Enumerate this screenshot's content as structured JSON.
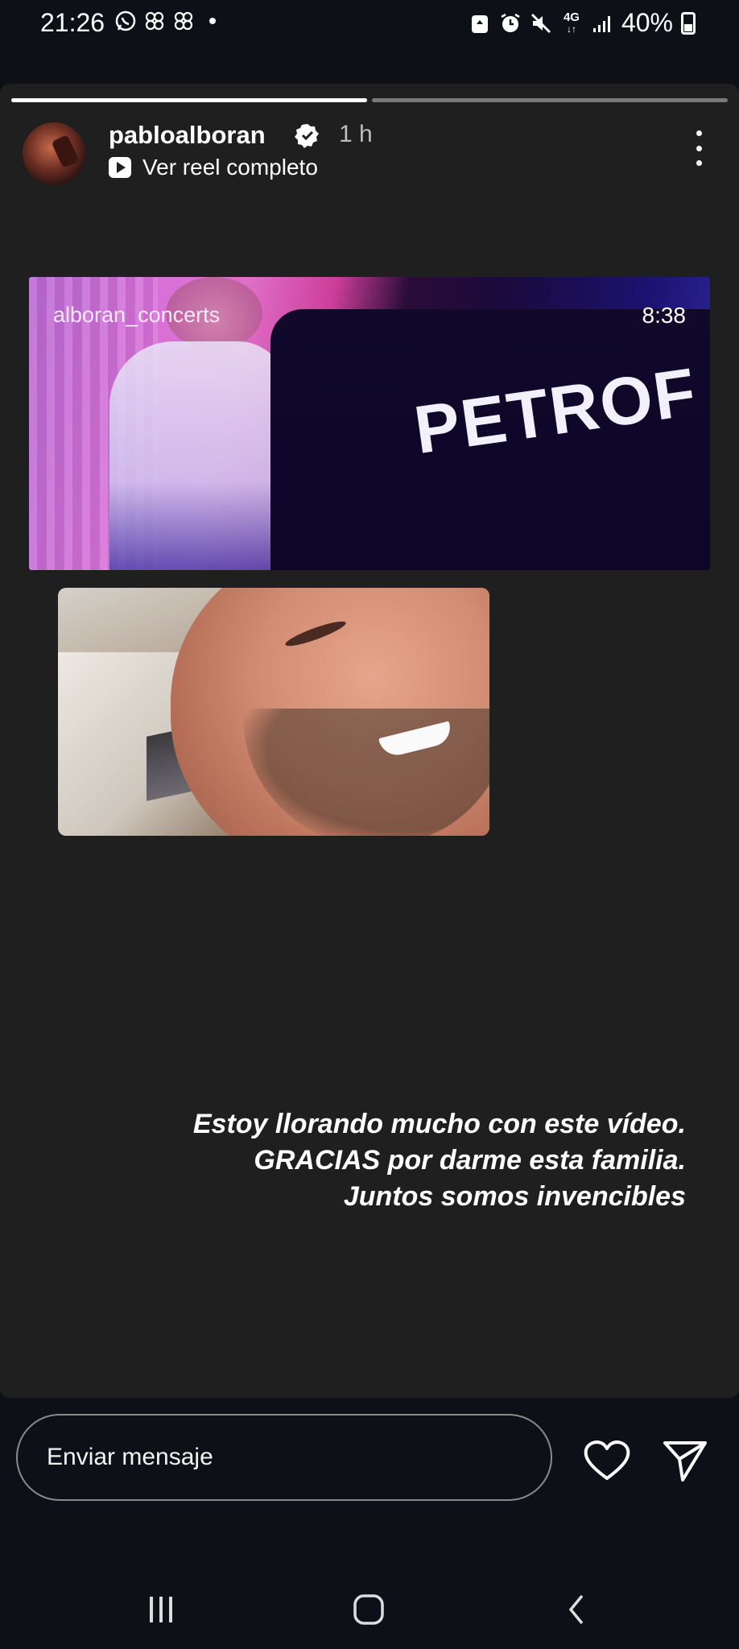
{
  "status_bar": {
    "time": "21:26",
    "left_icons": [
      "whatsapp-icon",
      "pinwheel-icon",
      "pinwheel-icon",
      "dot-icon"
    ],
    "right_icons": [
      "recycle-icon",
      "alarm-icon",
      "mute-icon",
      "signal-4g-icon",
      "signal-bars-icon",
      "battery-icon"
    ],
    "network": "4G",
    "battery": "40%"
  },
  "story": {
    "progress_segments": [
      1.0,
      0.0
    ],
    "username": "pabloalboran",
    "time_ago": "1 h",
    "reel_link": "Ver reel completo",
    "video": {
      "source_tag": "alboran_concerts",
      "duration": "8:38",
      "brand": "PETROF"
    },
    "caption_lines": [
      "Estoy llorando mucho con este vídeo.",
      "GRACIAS por darme esta familia.",
      "Juntos somos invencibles"
    ]
  },
  "reply": {
    "placeholder": "Enviar mensaje"
  },
  "colors": {
    "background": "#1f1f1f",
    "chrome": "#0d1117"
  }
}
